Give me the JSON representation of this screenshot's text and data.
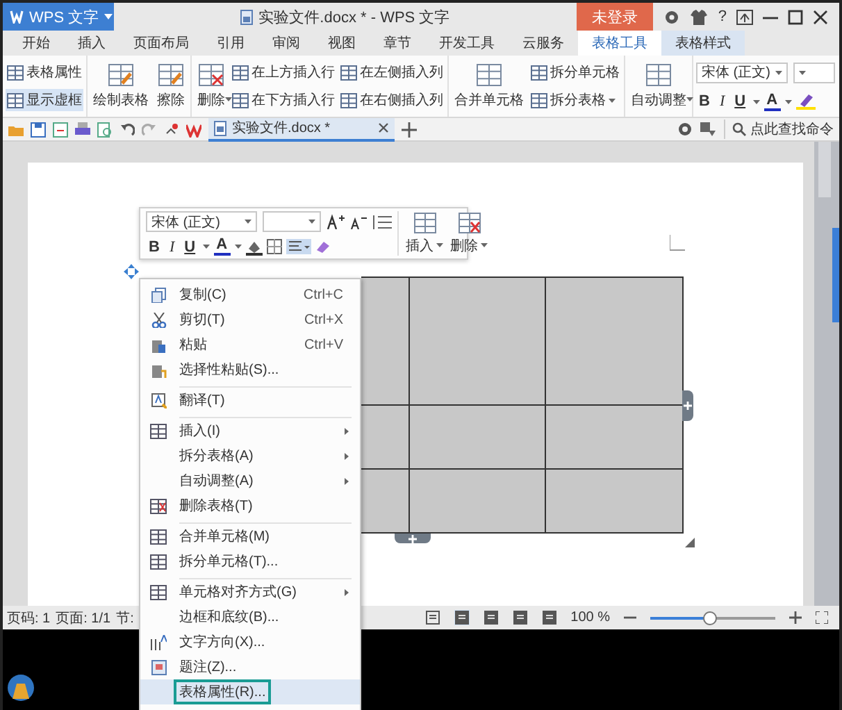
{
  "title_bar": {
    "app_button": "WPS 文字",
    "title": "实验文件.docx * - WPS 文字",
    "login_button": "未登录",
    "help": "?"
  },
  "menu_tabs": [
    {
      "label": "开始",
      "selected": false,
      "contextual": false
    },
    {
      "label": "插入",
      "selected": false,
      "contextual": false
    },
    {
      "label": "页面布局",
      "selected": false,
      "contextual": false
    },
    {
      "label": "引用",
      "selected": false,
      "contextual": false
    },
    {
      "label": "审阅",
      "selected": false,
      "contextual": false
    },
    {
      "label": "视图",
      "selected": false,
      "contextual": false
    },
    {
      "label": "章节",
      "selected": false,
      "contextual": false
    },
    {
      "label": "开发工具",
      "selected": false,
      "contextual": false
    },
    {
      "label": "云服务",
      "selected": false,
      "contextual": false
    },
    {
      "label": "表格工具",
      "selected": true,
      "contextual": true
    },
    {
      "label": "表格样式",
      "selected": false,
      "contextual": true
    }
  ],
  "ribbon": {
    "groups": [
      {
        "items": [
          {
            "label": "表格属性",
            "kind": "small",
            "dropdown": false,
            "on": false
          },
          {
            "label": "显示虚框",
            "kind": "small",
            "dropdown": false,
            "on": true
          }
        ]
      },
      {
        "items": [
          {
            "label": "绘制表格",
            "kind": "large",
            "dropdown": false,
            "on": false
          },
          {
            "label": "擦除",
            "kind": "large",
            "dropdown": false,
            "on": false
          }
        ]
      },
      {
        "items": [
          {
            "label": "删除",
            "kind": "large",
            "dropdown": true,
            "on": false
          },
          {
            "label": "在上方插入行",
            "kind": "small",
            "dropdown": false,
            "on": false
          },
          {
            "label": "在下方插入行",
            "kind": "small",
            "dropdown": false,
            "on": false
          },
          {
            "label": "在左侧插入列",
            "kind": "small",
            "dropdown": false,
            "on": false
          },
          {
            "label": "在右侧插入列",
            "kind": "small",
            "dropdown": false,
            "on": false
          }
        ]
      },
      {
        "items": [
          {
            "label": "合并单元格",
            "kind": "large",
            "dropdown": false,
            "on": false
          },
          {
            "label": "拆分单元格",
            "kind": "small",
            "dropdown": false,
            "on": false
          },
          {
            "label": "拆分表格",
            "kind": "small",
            "dropdown": true,
            "on": false
          }
        ]
      },
      {
        "items": [
          {
            "label": "自动调整",
            "kind": "large",
            "dropdown": true,
            "on": false
          }
        ]
      }
    ],
    "font": {
      "value": "宋体 (正文)"
    },
    "format_buttons": [
      "B",
      "I",
      "U",
      "A"
    ]
  },
  "doc_bar": {
    "tab": "实验文件.docx *",
    "search": "点此查找命令"
  },
  "mini_toolbar": {
    "font": "宋体 (正文)",
    "format_buttons": [
      "B",
      "I",
      "U",
      "A"
    ],
    "buttons": [
      "插入",
      "删除"
    ]
  },
  "context_menu": [
    {
      "label": "复制(C)",
      "shortcut": "Ctrl+C",
      "submenu": false,
      "separator_before": false,
      "highlighted": false
    },
    {
      "label": "剪切(T)",
      "shortcut": "Ctrl+X",
      "submenu": false,
      "separator_before": false,
      "highlighted": false
    },
    {
      "label": "粘贴",
      "shortcut": "Ctrl+V",
      "submenu": false,
      "separator_before": false,
      "highlighted": false
    },
    {
      "label": "选择性粘贴(S)...",
      "submenu": false,
      "separator_before": false,
      "highlighted": false
    },
    {
      "label": "翻译(T)",
      "submenu": false,
      "separator_before": true,
      "highlighted": false
    },
    {
      "label": "插入(I)",
      "submenu": true,
      "separator_before": true,
      "highlighted": false
    },
    {
      "label": "拆分表格(A)",
      "submenu": true,
      "separator_before": false,
      "highlighted": false
    },
    {
      "label": "自动调整(A)",
      "submenu": true,
      "separator_before": false,
      "highlighted": false
    },
    {
      "label": "删除表格(T)",
      "submenu": false,
      "separator_before": false,
      "highlighted": false
    },
    {
      "label": "合并单元格(M)",
      "submenu": false,
      "separator_before": true,
      "highlighted": false
    },
    {
      "label": "拆分单元格(T)...",
      "submenu": false,
      "separator_before": false,
      "highlighted": false
    },
    {
      "label": "单元格对齐方式(G)",
      "submenu": true,
      "separator_before": true,
      "highlighted": false
    },
    {
      "label": "边框和底纹(B)...",
      "submenu": false,
      "separator_before": false,
      "highlighted": false
    },
    {
      "label": "文字方向(X)...",
      "submenu": false,
      "separator_before": false,
      "highlighted": false
    },
    {
      "label": "题注(Z)...",
      "submenu": false,
      "separator_before": false,
      "highlighted": false
    },
    {
      "label": "表格属性(R)...",
      "submenu": false,
      "separator_before": false,
      "highlighted": true
    }
  ],
  "status_bar": {
    "page": "页码: 1",
    "pages": "页面: 1/1",
    "section": "节:",
    "zoom": "100 %",
    "zoom_slider": {
      "level": 0.48
    }
  }
}
